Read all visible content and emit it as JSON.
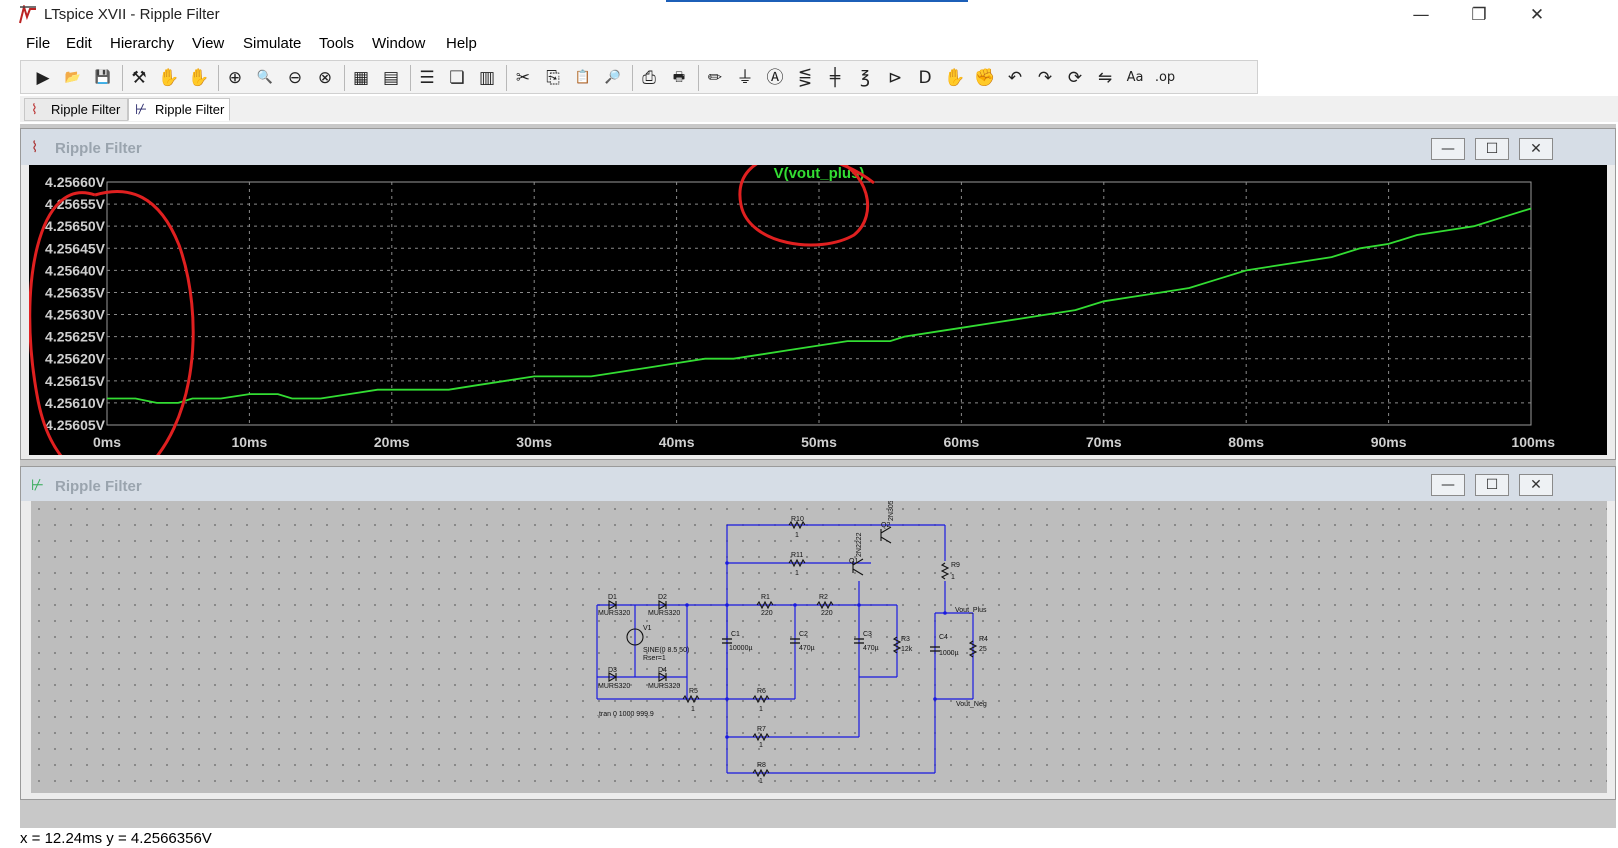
{
  "app": {
    "title": "LTspice XVII - Ripple Filter",
    "icon": "ltspice-logo-icon"
  },
  "window_controls": {
    "minimize": "—",
    "restore": "❐",
    "close": "✕"
  },
  "menu": [
    "File",
    "Edit",
    "Hierarchy",
    "View",
    "Simulate",
    "Tools",
    "Window",
    "Help"
  ],
  "toolbar": {
    "buttons": [
      {
        "icon": "run-icon",
        "glyph": "▶"
      },
      {
        "icon": "open-folder-icon",
        "glyph": "📂"
      },
      {
        "icon": "save-icon",
        "glyph": "💾"
      },
      {
        "icon": "control-panel-icon",
        "glyph": "⚒"
      },
      {
        "icon": "halt-icon",
        "glyph": "✋"
      },
      {
        "icon": "pan-icon",
        "glyph": "✋"
      },
      {
        "icon": "zoom-in-icon",
        "glyph": "⊕"
      },
      {
        "icon": "zoom-area-icon",
        "glyph": "🔍"
      },
      {
        "icon": "zoom-out-icon",
        "glyph": "⊖"
      },
      {
        "icon": "zoom-cancel-icon",
        "glyph": "⊗"
      },
      {
        "icon": "autorange-icon",
        "glyph": "▦"
      },
      {
        "icon": "fit-icon",
        "glyph": "▤"
      },
      {
        "icon": "tile-horizontal-icon",
        "glyph": "☰"
      },
      {
        "icon": "cascade-icon",
        "glyph": "❏"
      },
      {
        "icon": "tile-vertical-icon",
        "glyph": "▥"
      },
      {
        "icon": "cut-icon",
        "glyph": "✂"
      },
      {
        "icon": "copy-icon",
        "glyph": "⎘"
      },
      {
        "icon": "paste-icon",
        "glyph": "📋"
      },
      {
        "icon": "find-icon",
        "glyph": "🔎"
      },
      {
        "icon": "print-preview-icon",
        "glyph": "⎙"
      },
      {
        "icon": "print-icon",
        "glyph": "🖶"
      },
      {
        "icon": "wire-icon",
        "glyph": "✏"
      },
      {
        "icon": "ground-icon",
        "glyph": "⏚"
      },
      {
        "icon": "label-net-icon",
        "glyph": "Ⓐ"
      },
      {
        "icon": "resistor-icon",
        "glyph": "⋚"
      },
      {
        "icon": "capacitor-icon",
        "glyph": "╪"
      },
      {
        "icon": "inductor-icon",
        "glyph": "℥"
      },
      {
        "icon": "diode-icon",
        "glyph": "⊳"
      },
      {
        "icon": "component-icon",
        "glyph": "D"
      },
      {
        "icon": "move-icon",
        "glyph": "✋"
      },
      {
        "icon": "drag-icon",
        "glyph": "✊"
      },
      {
        "icon": "undo-icon",
        "glyph": "↶"
      },
      {
        "icon": "redo-icon",
        "glyph": "↷"
      },
      {
        "icon": "rotate-icon",
        "glyph": "⟳"
      },
      {
        "icon": "mirror-icon",
        "glyph": "⇋"
      },
      {
        "icon": "text-icon",
        "glyph": "Aa"
      },
      {
        "icon": "spice-directive-icon",
        "glyph": ".op"
      }
    ]
  },
  "tabs": [
    {
      "label": "Ripple Filter",
      "icon": "waveform-tab-icon",
      "active": false
    },
    {
      "label": "Ripple Filter",
      "icon": "schematic-tab-icon",
      "active": true
    }
  ],
  "plot_window": {
    "title": "Ripple Filter",
    "icon": "waveform-window-icon"
  },
  "schematic_window": {
    "title": "Ripple Filter",
    "icon": "schematic-window-icon"
  },
  "child_controls": {
    "minimize": "—",
    "maximize": "☐",
    "close": "✕"
  },
  "chart_data": {
    "type": "line",
    "title": "V(vout_plus)",
    "x_ticks": [
      "0ms",
      "10ms",
      "20ms",
      "30ms",
      "40ms",
      "50ms",
      "60ms",
      "70ms",
      "80ms",
      "90ms",
      "100ms"
    ],
    "y_ticks": [
      "4.25660V",
      "4.25655V",
      "4.25650V",
      "4.25645V",
      "4.25640V",
      "4.25635V",
      "4.25630V",
      "4.25625V",
      "4.25620V",
      "4.25615V",
      "4.25610V",
      "4.25605V"
    ],
    "xlim": [
      0,
      100
    ],
    "ylim": [
      4.25605,
      4.2566
    ],
    "grid": true,
    "series": [
      {
        "name": "V(vout_plus)",
        "color": "#33dd33",
        "x": [
          0,
          2,
          3.5,
          5,
          6,
          8,
          10,
          12,
          13,
          15,
          17,
          19,
          21,
          22,
          24,
          26,
          28,
          30,
          32,
          34,
          36,
          38,
          40,
          42,
          44,
          46,
          48,
          50,
          52,
          54,
          55,
          56,
          58,
          60,
          62,
          64,
          66,
          68,
          70,
          72,
          74,
          76,
          78,
          80,
          82,
          84,
          86,
          88,
          90,
          92,
          94,
          96,
          98,
          100
        ],
        "y": [
          4.25611,
          4.25611,
          4.2561,
          4.2561,
          4.25611,
          4.25611,
          4.25612,
          4.25612,
          4.25611,
          4.25611,
          4.25612,
          4.25613,
          4.25613,
          4.25613,
          4.25613,
          4.25614,
          4.25615,
          4.25616,
          4.25616,
          4.25616,
          4.25617,
          4.25618,
          4.25619,
          4.2562,
          4.2562,
          4.25621,
          4.25622,
          4.25623,
          4.25624,
          4.25624,
          4.25624,
          4.25625,
          4.25626,
          4.25627,
          4.25628,
          4.25629,
          4.2563,
          4.25631,
          4.25633,
          4.25634,
          4.25635,
          4.25636,
          4.25638,
          4.2564,
          4.25641,
          4.25642,
          4.25643,
          4.25645,
          4.25646,
          4.25648,
          4.25649,
          4.2565,
          4.25652,
          4.25654
        ]
      }
    ]
  },
  "schematic": {
    "labels": [
      {
        "text": "R10"
      },
      {
        "text": "1"
      },
      {
        "text": "R11"
      },
      {
        "text": "1"
      },
      {
        "text": "Q2"
      },
      {
        "text": "2N3055"
      },
      {
        "text": "Q1"
      },
      {
        "text": "2N2222"
      },
      {
        "text": "R9"
      },
      {
        "text": "1"
      },
      {
        "text": "D1"
      },
      {
        "text": "MURS320"
      },
      {
        "text": "D2"
      },
      {
        "text": "MURS320"
      },
      {
        "text": "R1"
      },
      {
        "text": "220"
      },
      {
        "text": "R2"
      },
      {
        "text": "220"
      },
      {
        "text": "Vout_Plus"
      },
      {
        "text": "V1"
      },
      {
        "text": "C1"
      },
      {
        "text": "10000µ"
      },
      {
        "text": "C2"
      },
      {
        "text": "470µ"
      },
      {
        "text": "C3"
      },
      {
        "text": "470µ"
      },
      {
        "text": "R3"
      },
      {
        "text": "12k"
      },
      {
        "text": "C4"
      },
      {
        "text": "1000µ"
      },
      {
        "text": "R4"
      },
      {
        "text": "25"
      },
      {
        "text": "SINE(0 8.5 50)"
      },
      {
        "text": "Rser=1"
      },
      {
        "text": "D3"
      },
      {
        "text": "MURS320"
      },
      {
        "text": "D4"
      },
      {
        "text": "MURS320"
      },
      {
        "text": "R5"
      },
      {
        "text": "1"
      },
      {
        "text": "R6"
      },
      {
        "text": "1"
      },
      {
        "text": "Vout_Neg"
      },
      {
        "text": ".tran 0 1000 999.9"
      },
      {
        "text": "R7"
      },
      {
        "text": "1"
      },
      {
        "text": "R8"
      },
      {
        "text": "1"
      }
    ]
  },
  "status": {
    "cursor_readout": "x = 12.24ms    y = 4.2566356V"
  }
}
